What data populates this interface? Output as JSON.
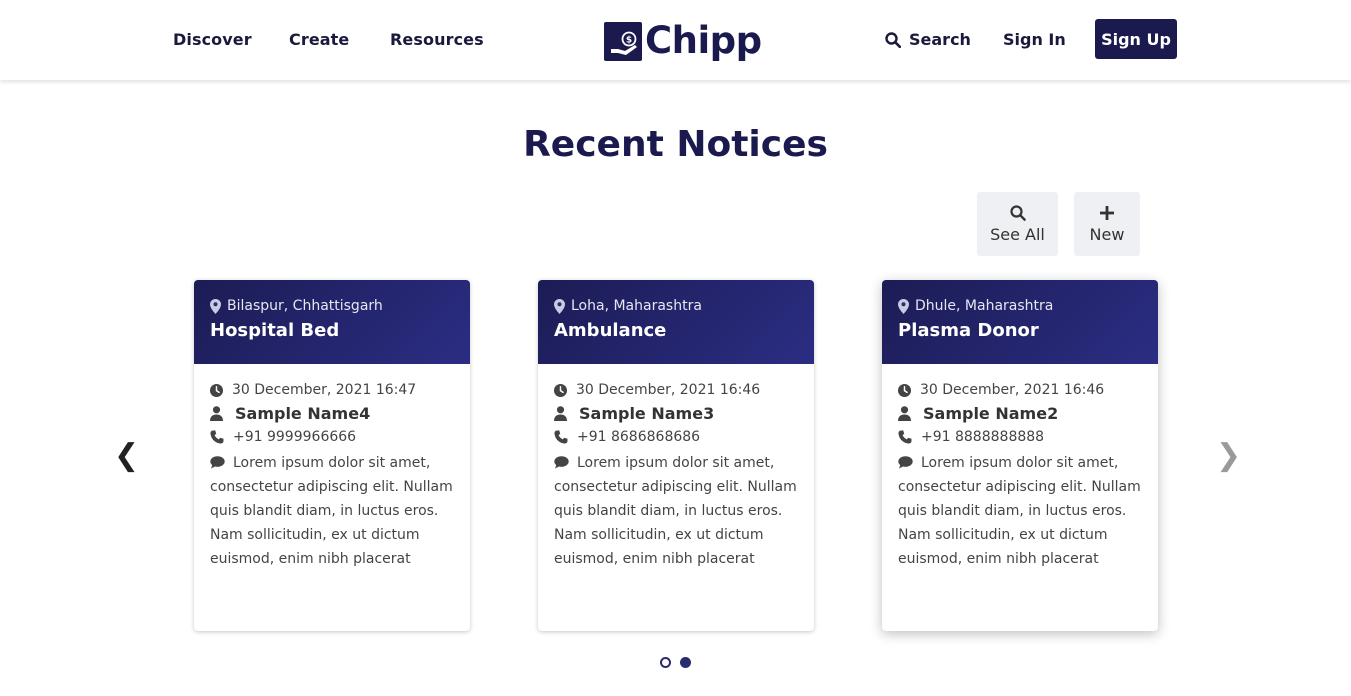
{
  "header": {
    "nav": [
      "Discover",
      "Create",
      "Resources"
    ],
    "logo_text": "Chipp",
    "search_label": "Search",
    "signin_label": "Sign In",
    "signup_label": "Sign Up"
  },
  "section": {
    "title": "Recent Notices"
  },
  "actions": {
    "see_all": "See All",
    "new": "New"
  },
  "cards": [
    {
      "location": "Bilaspur, Chhattisgarh",
      "title": "Hospital Bed",
      "datetime": "30 December, 2021 16:47",
      "name": "Sample Name4",
      "phone": "+91 9999966666",
      "description": "Lorem ipsum dolor sit amet, consectetur adipiscing elit. Nullam quis blandit diam, in luctus eros. Nam sollicitudin, ex ut dictum euismod, enim nibh placerat"
    },
    {
      "location": "Loha, Maharashtra",
      "title": "Ambulance",
      "datetime": "30 December, 2021 16:46",
      "name": "Sample Name3",
      "phone": "+91 8686868686",
      "description": "Lorem ipsum dolor sit amet, consectetur adipiscing elit. Nullam quis blandit diam, in luctus eros. Nam sollicitudin, ex ut dictum euismod, enim nibh placerat"
    },
    {
      "location": "Dhule, Maharashtra",
      "title": "Plasma Donor",
      "datetime": "30 December, 2021 16:46",
      "name": "Sample Name2",
      "phone": "+91 8888888888",
      "description": "Lorem ipsum dolor sit amet, consectetur adipiscing elit. Nullam quis blandit diam, in luctus eros. Nam sollicitudin, ex ut dictum euismod, enim nibh placerat"
    }
  ],
  "carousel": {
    "prev": "❮",
    "next": "❯",
    "pages": 2,
    "active_page": 2
  },
  "colors": {
    "brand": "#1b1a4f",
    "card_header": "#25266d"
  },
  "icons": [
    "search-icon",
    "location-pin-icon",
    "clock-icon",
    "user-icon",
    "phone-icon",
    "comment-icon",
    "plus-icon",
    "logo-hand-coin-icon"
  ]
}
